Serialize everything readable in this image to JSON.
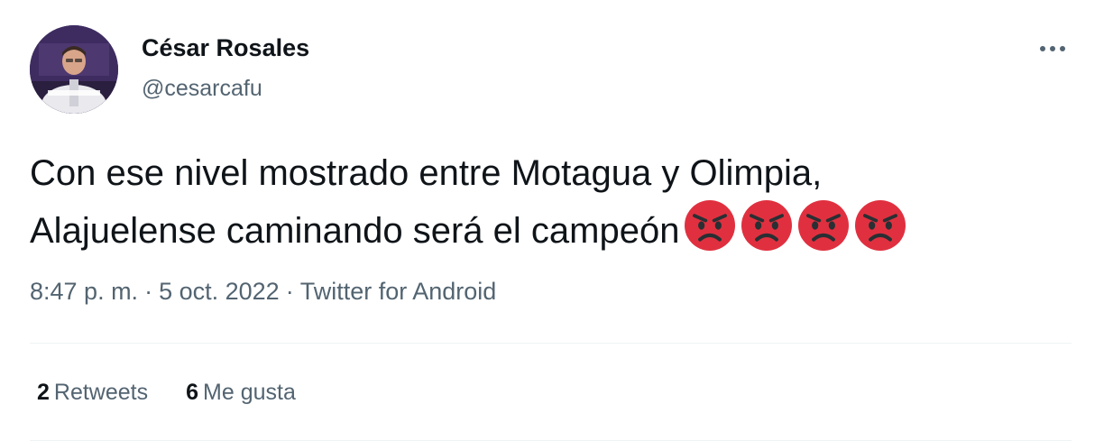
{
  "author": {
    "display_name": "César Rosales",
    "handle": "@cesarcafu",
    "avatar_icon": "profile-photo"
  },
  "tweet": {
    "text_lines": [
      "Con ese nivel mostrado entre Motagua y Olimpia,",
      "Alajuelense caminando será el campeón"
    ],
    "emojis": [
      "angry-face-icon",
      "angry-face-icon",
      "angry-face-icon",
      "angry-face-icon"
    ]
  },
  "meta": {
    "time": "8:47 p. m.",
    "separator": "·",
    "date": "5 oct. 2022",
    "source": "Twitter for Android"
  },
  "stats": {
    "retweets": {
      "count": "2",
      "label": "Retweets"
    },
    "likes": {
      "count": "6",
      "label": "Me gusta"
    }
  },
  "colors": {
    "text_primary": "#0f1419",
    "text_secondary": "#536471",
    "divider": "#eff3f4",
    "emoji_red": "#e0303f"
  }
}
